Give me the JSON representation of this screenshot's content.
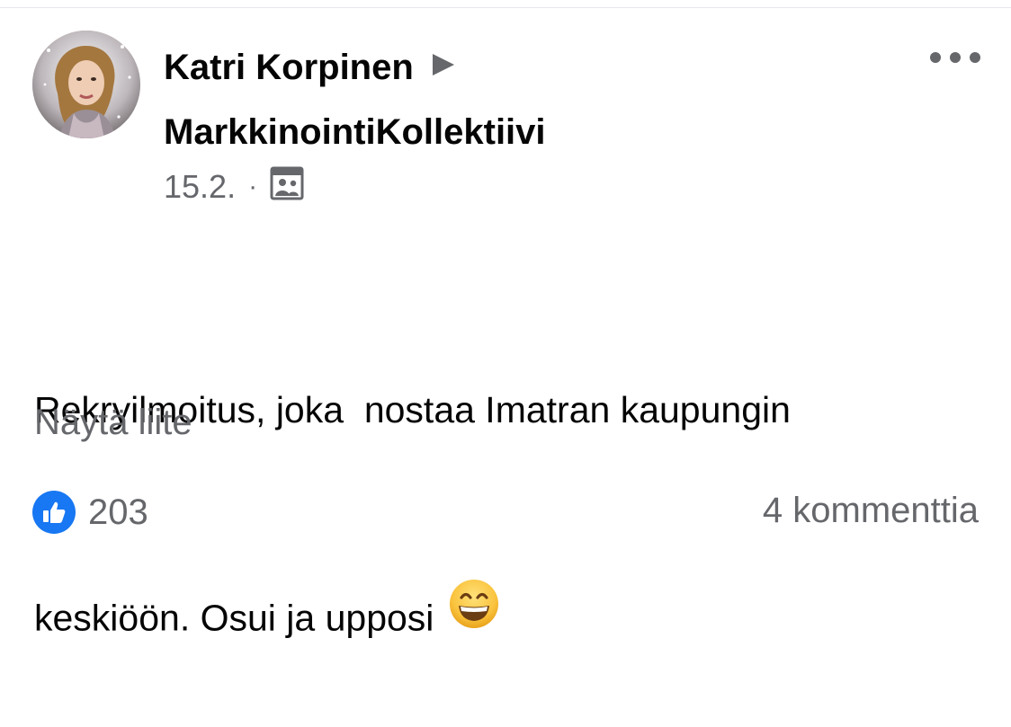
{
  "post": {
    "author": "Katri Korpinen",
    "group": "MarkkinointiKollektiivi",
    "date": "15.2.",
    "meta_separator": "·",
    "audience_icon": "group-icon",
    "text_line1": "Rekryilmoitus, joka  nostaa Imatran kaupungin",
    "text_line2": "keskiöön. Osui ja upposi",
    "emoji": "grinning-face-with-smiling-eyes",
    "attachment_label": "Näytä liite",
    "reaction_count": "203",
    "comments_label": "4 kommenttia"
  },
  "colors": {
    "secondary_text": "#65676b",
    "primary_text": "#050505",
    "like_blue": "#1877f2"
  }
}
